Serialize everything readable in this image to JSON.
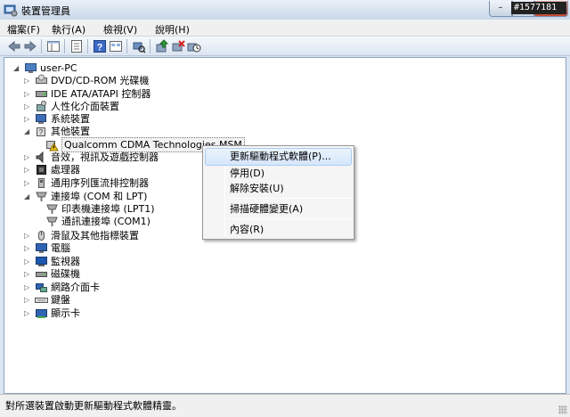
{
  "window": {
    "title": "裝置管理員",
    "watermark": "#1577181",
    "controls": {
      "minimize": "–",
      "maximize": "□",
      "close": "x"
    }
  },
  "menubar": [
    "檔案(F)",
    "執行(A)",
    "檢視(V)",
    "說明(H)"
  ],
  "toolbar": {
    "icons": [
      "back-icon",
      "forward-icon",
      "show-hide-tree-icon",
      "properties-icon",
      "help-icon",
      "view-icon",
      "scan-hardware-icon",
      "update-driver-icon",
      "uninstall-icon",
      "disable-icon"
    ]
  },
  "tree": {
    "root": "user-PC",
    "nodes": [
      {
        "label": "DVD/CD-ROM 光碟機",
        "icon": "dvd-drive-icon"
      },
      {
        "label": "IDE ATA/ATAPI 控制器",
        "icon": "ide-controller-icon"
      },
      {
        "label": "人性化介面裝置",
        "icon": "hid-icon"
      },
      {
        "label": "系統裝置",
        "icon": "system-device-icon"
      },
      {
        "label": "其他裝置",
        "icon": "other-devices-icon",
        "expanded": true,
        "children": [
          {
            "label": "Qualcomm CDMA Technologies MSM",
            "icon": "warning-device-icon",
            "selected": true
          }
        ]
      },
      {
        "label": "音效，視訊及遊戲控制器",
        "icon": "sound-icon"
      },
      {
        "label": "處理器",
        "icon": "processor-icon"
      },
      {
        "label": "通用序列匯流排控制器",
        "icon": "usb-icon"
      },
      {
        "label": "連接埠 (COM 和 LPT)",
        "icon": "port-icon",
        "expanded": true,
        "children": [
          {
            "label": "印表機連接埠 (LPT1)",
            "icon": "port-icon"
          },
          {
            "label": "通訊連接埠 (COM1)",
            "icon": "port-icon"
          }
        ]
      },
      {
        "label": "滑鼠及其他指標裝置",
        "icon": "mouse-icon"
      },
      {
        "label": "電腦",
        "icon": "computer-icon"
      },
      {
        "label": "監視器",
        "icon": "monitor-icon"
      },
      {
        "label": "磁碟機",
        "icon": "disk-drive-icon"
      },
      {
        "label": "網路介面卡",
        "icon": "network-adapter-icon"
      },
      {
        "label": "鍵盤",
        "icon": "keyboard-icon"
      },
      {
        "label": "顯示卡",
        "icon": "display-adapter-icon"
      }
    ]
  },
  "context_menu": {
    "items": [
      {
        "label": "更新驅動程式軟體(P)...",
        "highlighted": true
      },
      {
        "label": "停用(D)"
      },
      {
        "label": "解除安裝(U)"
      },
      {
        "separator": true
      },
      {
        "label": "掃描硬體變更(A)"
      },
      {
        "separator": true
      },
      {
        "label": "內容(R)"
      }
    ]
  },
  "statusbar": {
    "text": "對所選裝置啟動更新驅動程式軟體精靈。"
  },
  "colors": {
    "accent": "#3a78c8",
    "warning": "#f3c31a",
    "selection_highlight": "#d5e7fb"
  }
}
